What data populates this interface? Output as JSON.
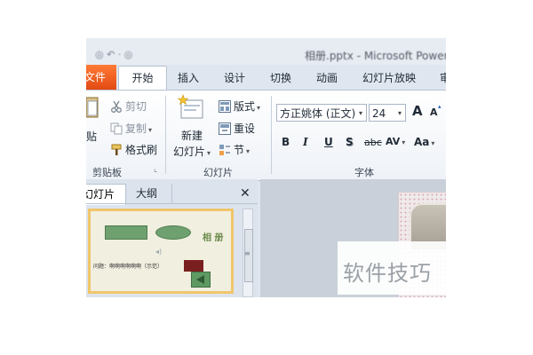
{
  "window": {
    "title": "相册.pptx - Microsoft PowerPoint",
    "quick_access": "◎  ↶  ·  ◎"
  },
  "tabs": [
    {
      "label": "文件"
    },
    {
      "label": "开始"
    },
    {
      "label": "插入"
    },
    {
      "label": "设计"
    },
    {
      "label": "切换"
    },
    {
      "label": "动画"
    },
    {
      "label": "幻灯片放映"
    },
    {
      "label": "审"
    }
  ],
  "clipboard": {
    "paste_label": "贴",
    "cut_label": "剪切",
    "copy_label": "复制",
    "format_painter_label": "格式刷",
    "group_label": "剪贴板",
    "launcher": "⌞"
  },
  "slides": {
    "new_slide_line1": "新建",
    "new_slide_line2": "幻灯片",
    "layout_label": "版式",
    "reset_label": "重设",
    "section_label": "节",
    "group_label": "幻灯片"
  },
  "font": {
    "family": "方正姚体 (正文)",
    "size": "24",
    "grow_label": "A",
    "shrink_label": "A",
    "bold": "B",
    "italic": "I",
    "underline": "U",
    "shadow": "S",
    "strikethrough": "abc",
    "spacing": "AV",
    "change_case": "Aa",
    "group_label": "字体"
  },
  "panel": {
    "tab_slides": "幻灯片",
    "tab_outline": "大纲",
    "close_glyph": "✕",
    "thumb_title": "相 册",
    "thumb_caption": "问题：啊啊啊啊啊啊（示范）"
  },
  "watermark": {
    "text": "软件技巧"
  },
  "colors": {
    "file_tab": "#e24a12",
    "selected_slide_border": "#f0c66b",
    "shape_green": "#6fa06f"
  }
}
